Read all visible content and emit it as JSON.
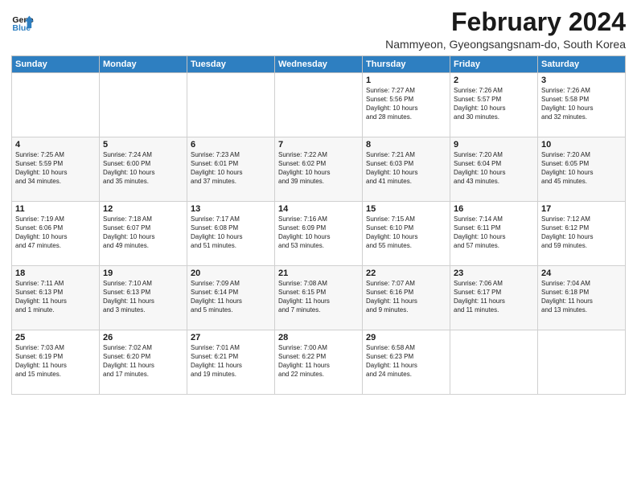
{
  "logo": {
    "text_general": "General",
    "text_blue": "Blue"
  },
  "title": "February 2024",
  "subtitle": "Nammyeon, Gyeongsangsnam-do, South Korea",
  "days_header": [
    "Sunday",
    "Monday",
    "Tuesday",
    "Wednesday",
    "Thursday",
    "Friday",
    "Saturday"
  ],
  "weeks": [
    [
      {
        "day": "",
        "content": ""
      },
      {
        "day": "",
        "content": ""
      },
      {
        "day": "",
        "content": ""
      },
      {
        "day": "",
        "content": ""
      },
      {
        "day": "1",
        "content": "Sunrise: 7:27 AM\nSunset: 5:56 PM\nDaylight: 10 hours\nand 28 minutes."
      },
      {
        "day": "2",
        "content": "Sunrise: 7:26 AM\nSunset: 5:57 PM\nDaylight: 10 hours\nand 30 minutes."
      },
      {
        "day": "3",
        "content": "Sunrise: 7:26 AM\nSunset: 5:58 PM\nDaylight: 10 hours\nand 32 minutes."
      }
    ],
    [
      {
        "day": "4",
        "content": "Sunrise: 7:25 AM\nSunset: 5:59 PM\nDaylight: 10 hours\nand 34 minutes."
      },
      {
        "day": "5",
        "content": "Sunrise: 7:24 AM\nSunset: 6:00 PM\nDaylight: 10 hours\nand 35 minutes."
      },
      {
        "day": "6",
        "content": "Sunrise: 7:23 AM\nSunset: 6:01 PM\nDaylight: 10 hours\nand 37 minutes."
      },
      {
        "day": "7",
        "content": "Sunrise: 7:22 AM\nSunset: 6:02 PM\nDaylight: 10 hours\nand 39 minutes."
      },
      {
        "day": "8",
        "content": "Sunrise: 7:21 AM\nSunset: 6:03 PM\nDaylight: 10 hours\nand 41 minutes."
      },
      {
        "day": "9",
        "content": "Sunrise: 7:20 AM\nSunset: 6:04 PM\nDaylight: 10 hours\nand 43 minutes."
      },
      {
        "day": "10",
        "content": "Sunrise: 7:20 AM\nSunset: 6:05 PM\nDaylight: 10 hours\nand 45 minutes."
      }
    ],
    [
      {
        "day": "11",
        "content": "Sunrise: 7:19 AM\nSunset: 6:06 PM\nDaylight: 10 hours\nand 47 minutes."
      },
      {
        "day": "12",
        "content": "Sunrise: 7:18 AM\nSunset: 6:07 PM\nDaylight: 10 hours\nand 49 minutes."
      },
      {
        "day": "13",
        "content": "Sunrise: 7:17 AM\nSunset: 6:08 PM\nDaylight: 10 hours\nand 51 minutes."
      },
      {
        "day": "14",
        "content": "Sunrise: 7:16 AM\nSunset: 6:09 PM\nDaylight: 10 hours\nand 53 minutes."
      },
      {
        "day": "15",
        "content": "Sunrise: 7:15 AM\nSunset: 6:10 PM\nDaylight: 10 hours\nand 55 minutes."
      },
      {
        "day": "16",
        "content": "Sunrise: 7:14 AM\nSunset: 6:11 PM\nDaylight: 10 hours\nand 57 minutes."
      },
      {
        "day": "17",
        "content": "Sunrise: 7:12 AM\nSunset: 6:12 PM\nDaylight: 10 hours\nand 59 minutes."
      }
    ],
    [
      {
        "day": "18",
        "content": "Sunrise: 7:11 AM\nSunset: 6:13 PM\nDaylight: 11 hours\nand 1 minute."
      },
      {
        "day": "19",
        "content": "Sunrise: 7:10 AM\nSunset: 6:13 PM\nDaylight: 11 hours\nand 3 minutes."
      },
      {
        "day": "20",
        "content": "Sunrise: 7:09 AM\nSunset: 6:14 PM\nDaylight: 11 hours\nand 5 minutes."
      },
      {
        "day": "21",
        "content": "Sunrise: 7:08 AM\nSunset: 6:15 PM\nDaylight: 11 hours\nand 7 minutes."
      },
      {
        "day": "22",
        "content": "Sunrise: 7:07 AM\nSunset: 6:16 PM\nDaylight: 11 hours\nand 9 minutes."
      },
      {
        "day": "23",
        "content": "Sunrise: 7:06 AM\nSunset: 6:17 PM\nDaylight: 11 hours\nand 11 minutes."
      },
      {
        "day": "24",
        "content": "Sunrise: 7:04 AM\nSunset: 6:18 PM\nDaylight: 11 hours\nand 13 minutes."
      }
    ],
    [
      {
        "day": "25",
        "content": "Sunrise: 7:03 AM\nSunset: 6:19 PM\nDaylight: 11 hours\nand 15 minutes."
      },
      {
        "day": "26",
        "content": "Sunrise: 7:02 AM\nSunset: 6:20 PM\nDaylight: 11 hours\nand 17 minutes."
      },
      {
        "day": "27",
        "content": "Sunrise: 7:01 AM\nSunset: 6:21 PM\nDaylight: 11 hours\nand 19 minutes."
      },
      {
        "day": "28",
        "content": "Sunrise: 7:00 AM\nSunset: 6:22 PM\nDaylight: 11 hours\nand 22 minutes."
      },
      {
        "day": "29",
        "content": "Sunrise: 6:58 AM\nSunset: 6:23 PM\nDaylight: 11 hours\nand 24 minutes."
      },
      {
        "day": "",
        "content": ""
      },
      {
        "day": "",
        "content": ""
      }
    ]
  ]
}
